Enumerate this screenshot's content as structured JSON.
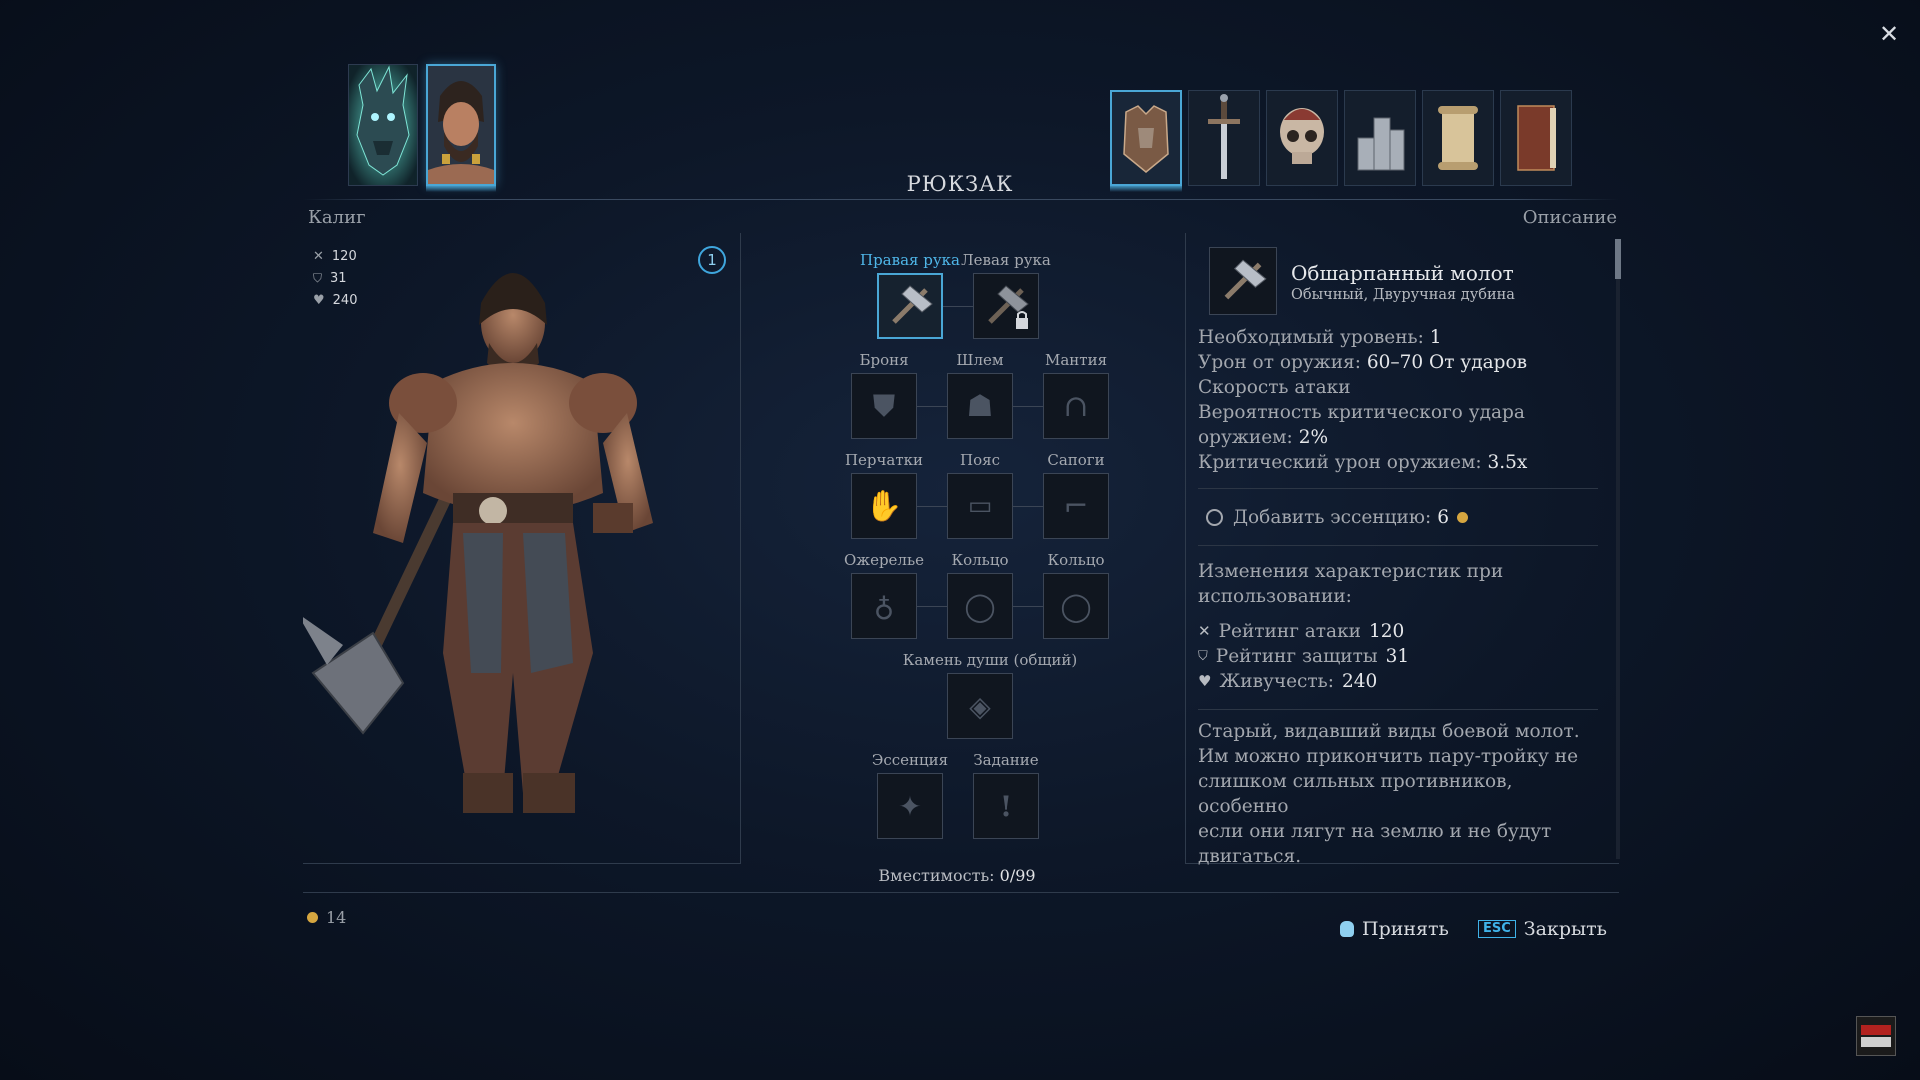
{
  "window": {
    "close_glyph": "✕"
  },
  "panel_title": "РЮКЗАК",
  "character": {
    "name": "Калиг",
    "stats": [
      {
        "icon": "crossed-swords-icon",
        "value": "120"
      },
      {
        "icon": "shield-icon",
        "value": "31"
      },
      {
        "icon": "heart-icon",
        "value": "240"
      }
    ],
    "level_badge": "1"
  },
  "description_header": "Описание",
  "equipment": {
    "right_hand": "Правая рука",
    "left_hand": "Левая рука",
    "armor": "Броня",
    "helmet": "Шлем",
    "cloak": "Мантия",
    "gloves": "Перчатки",
    "belt": "Пояс",
    "boots": "Сапоги",
    "necklace": "Ожерелье",
    "ring1": "Кольцо",
    "ring2": "Кольцо",
    "soulstone": "Камень души (общий)",
    "essence": "Эссенция",
    "quest": "Задание",
    "capacity_label": "Вместимость:",
    "capacity_value": "0/99"
  },
  "item": {
    "name": "Обшарпанный молот",
    "type": "Обычный, Двуручная дубина",
    "req_level_label": "Необходимый уровень:",
    "req_level_value": "1",
    "damage_label": "Урон от оружия:",
    "damage_value": "60–70 От ударов",
    "speed_label": "Скорость атаки",
    "crit_chance_label_1": "Вероятность критического удара",
    "crit_chance_label_2": "оружием:",
    "crit_chance_value": "2%",
    "crit_damage_label": "Критический урон оружием:",
    "crit_damage_value": "3.5x",
    "essence_label": "Добавить эссенцию:",
    "essence_value": "6",
    "changes_title_1": "Изменения характеристик при",
    "changes_title_2": "использовании:",
    "changes": [
      {
        "icon": "crossed-swords-icon",
        "label": "Рейтинг атаки",
        "value": "120"
      },
      {
        "icon": "shield-icon",
        "label": "Рейтинг защиты",
        "value": "31"
      },
      {
        "icon": "heart-icon",
        "label": "Живучесть:",
        "value": "240"
      }
    ],
    "lore": [
      "Старый, видавший виды боевой молот.",
      "Им можно прикончить пару-тройку не",
      "слишком сильных противников, особенно",
      "если они лягут на землю и не будут",
      "двигаться."
    ]
  },
  "gold": "14",
  "buttons": {
    "accept": "Принять",
    "esc_key": "ESC",
    "close": "Закрыть"
  },
  "colors": {
    "accent": "#4aa7d6",
    "gold": "#d6a640",
    "bg": "#0d1728"
  }
}
